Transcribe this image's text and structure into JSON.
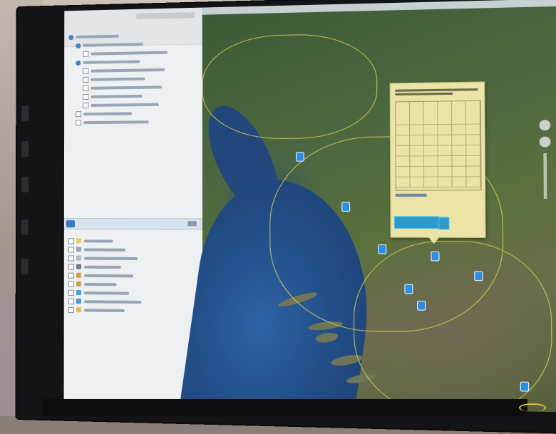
{
  "scene": {
    "description_free": true,
    "colors": {
      "sea": "#224d86",
      "land": "#4d6840",
      "popup_background": "#ebe4a6",
      "popup_button": "#2d9bc9",
      "map_marker": "#2d8ee3",
      "border_lines": "#d8d35a",
      "left_panel": "#eef1f2"
    },
    "icons": [
      "map-marker-icon",
      "zoom-in-icon",
      "zoom-out-icon",
      "layer-checkbox-icon",
      "globe-icon"
    ]
  },
  "left_panel": {
    "tree_rows": [
      {
        "level": 0,
        "kind": "globe"
      },
      {
        "level": 1,
        "kind": "globe"
      },
      {
        "level": 2,
        "kind": "check"
      },
      {
        "level": 1,
        "kind": "globe"
      },
      {
        "level": 2,
        "kind": "check"
      },
      {
        "level": 2,
        "kind": "check"
      },
      {
        "level": 2,
        "kind": "check"
      },
      {
        "level": 2,
        "kind": "check"
      },
      {
        "level": 2,
        "kind": "check"
      },
      {
        "level": 1,
        "kind": "check"
      },
      {
        "level": 1,
        "kind": "check"
      }
    ],
    "legend_rows": [
      {
        "swatch": "#e8d36a"
      },
      {
        "swatch": "#9fa8b0"
      },
      {
        "swatch": "#b4bcc3"
      },
      {
        "swatch": "#6e7b8a"
      },
      {
        "swatch": "#d89b4a"
      },
      {
        "swatch": "#c8a24a"
      },
      {
        "swatch": "#3fa7e0"
      },
      {
        "swatch": "#4d9bd6"
      },
      {
        "swatch": "#e8b84a"
      }
    ]
  },
  "map": {
    "popup": {
      "table_rows": 8,
      "table_columns": 6
    },
    "markers_count": 9
  }
}
